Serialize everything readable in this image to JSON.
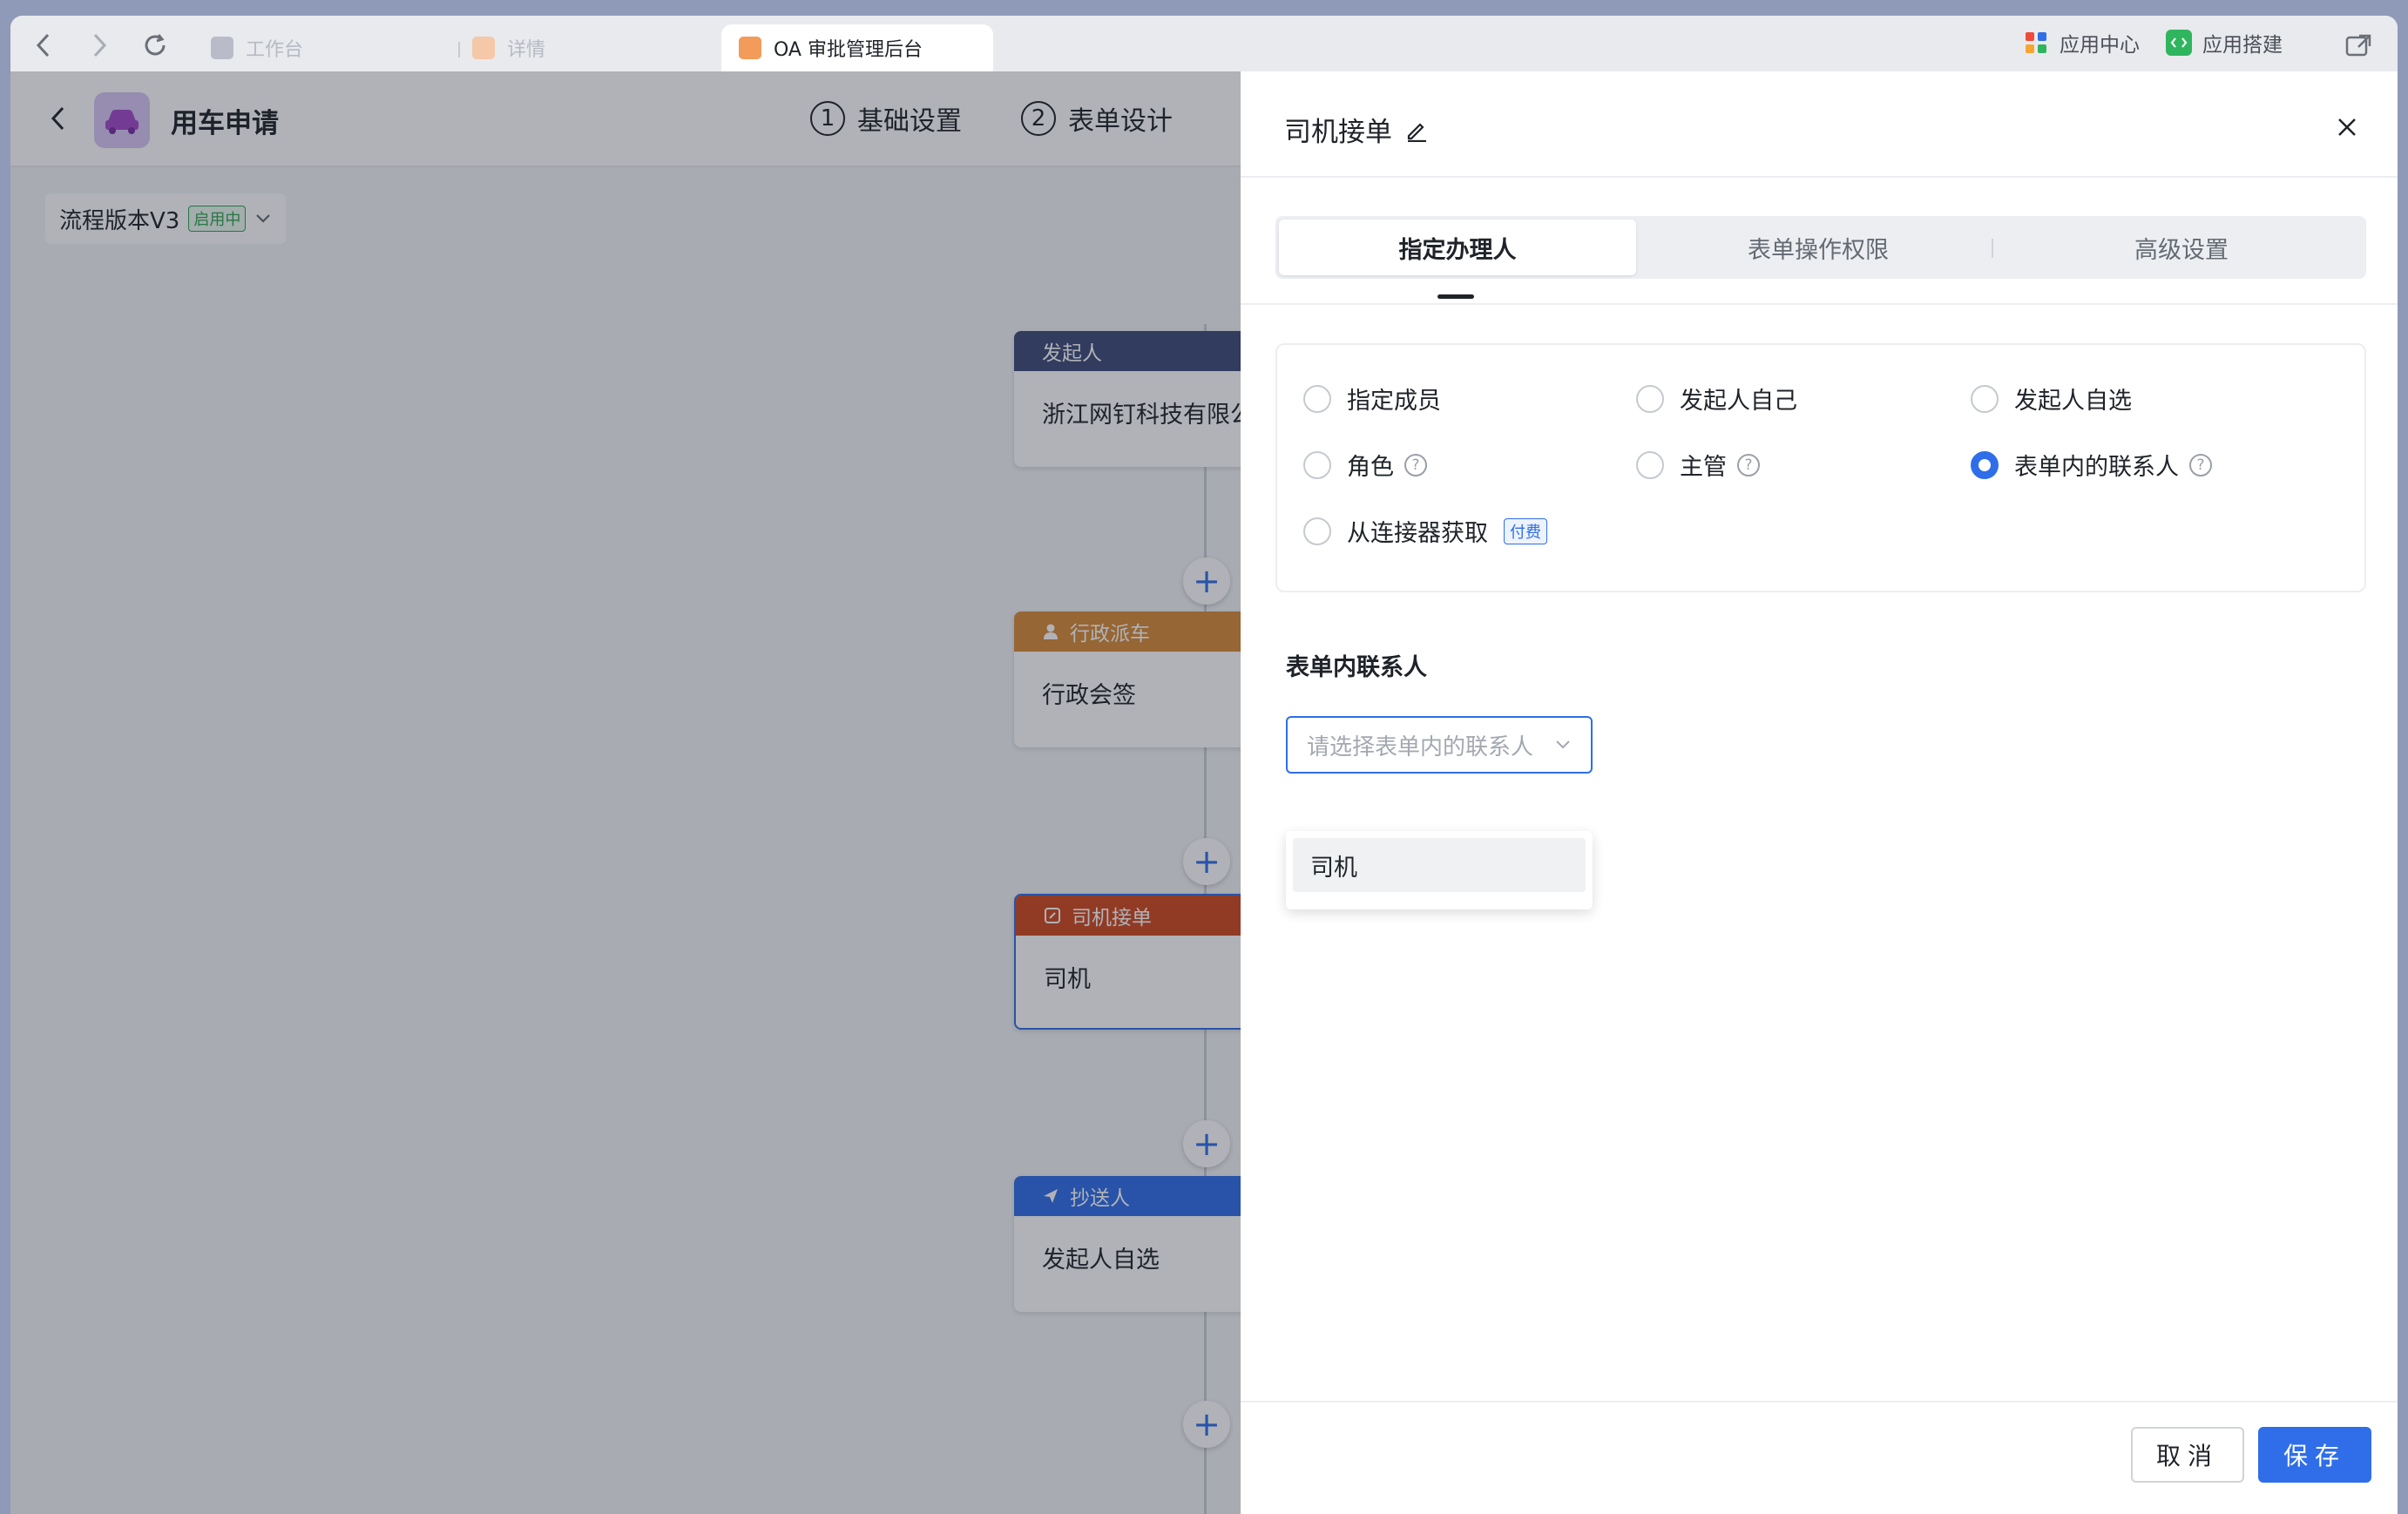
{
  "browser": {
    "tabs": [
      {
        "label": "工作台"
      },
      {
        "label": "详情"
      },
      {
        "label": "OA 审批管理后台"
      }
    ],
    "app_center": "应用中心",
    "app_builder": "应用搭建"
  },
  "workspace": {
    "title": "用车申请",
    "steps": [
      {
        "num": "1",
        "label": "基础设置"
      },
      {
        "num": "2",
        "label": "表单设计"
      }
    ],
    "version": "流程版本V3",
    "version_status": "启用中",
    "nodes": [
      {
        "head": "发起人",
        "body": "浙江网钉科技有限公",
        "color": "#3c4a79"
      },
      {
        "head": "行政派车",
        "body": "行政会签",
        "color": "#d88a37"
      },
      {
        "head": "司机接单",
        "body": "司机",
        "color": "#d0491f"
      },
      {
        "head": "抄送人",
        "body": "发起人自选",
        "color": "#2f6ee8"
      }
    ]
  },
  "drawer": {
    "title": "司机接单",
    "tabs": [
      "指定办理人",
      "表单操作权限",
      "高级设置"
    ],
    "options": [
      {
        "label": "指定成员",
        "checked": false
      },
      {
        "label": "发起人自己",
        "checked": false
      },
      {
        "label": "发起人自选",
        "checked": false
      },
      {
        "label": "角色",
        "checked": false
      },
      {
        "label": "主管",
        "checked": false
      },
      {
        "label": "表单内的联系人",
        "checked": true
      },
      {
        "label": "从连接器获取",
        "checked": false
      }
    ],
    "paid_badge": "付费",
    "section_label": "表单内联系人",
    "select_placeholder": "请选择表单内的联系人",
    "dropdown_items": [
      "司机"
    ],
    "cancel": "取消",
    "save": "保存"
  },
  "colors": {
    "accent": "#2f6ee8"
  }
}
